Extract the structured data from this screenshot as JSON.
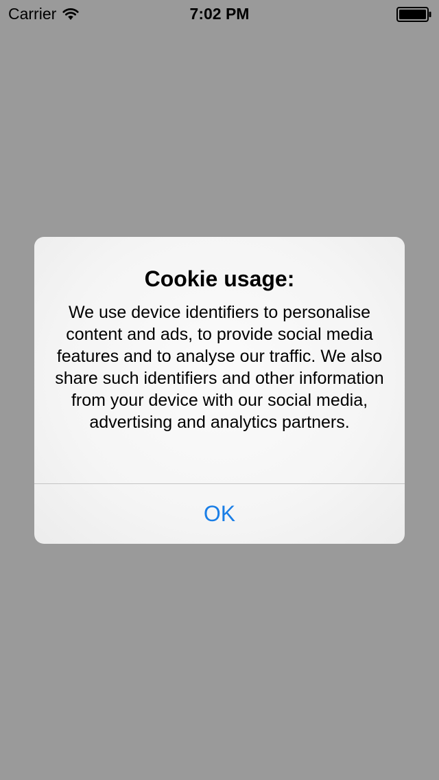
{
  "status_bar": {
    "carrier": "Carrier",
    "time": "7:02 PM",
    "wifi_icon": "wifi-icon",
    "battery_icon": "battery-icon"
  },
  "alert": {
    "title": "Cookie usage:",
    "message": "We use device identifiers to personalise content and ads, to provide social media features and to analyse our traffic. We also share such identifiers and other information from your device with our social media, advertising and analytics partners.",
    "button_label": "OK"
  },
  "colors": {
    "background_dim": "#9a9a9a",
    "alert_background": "#f7f7f7",
    "button_tint": "#1a7ee6",
    "divider": "#c4c4c4"
  }
}
